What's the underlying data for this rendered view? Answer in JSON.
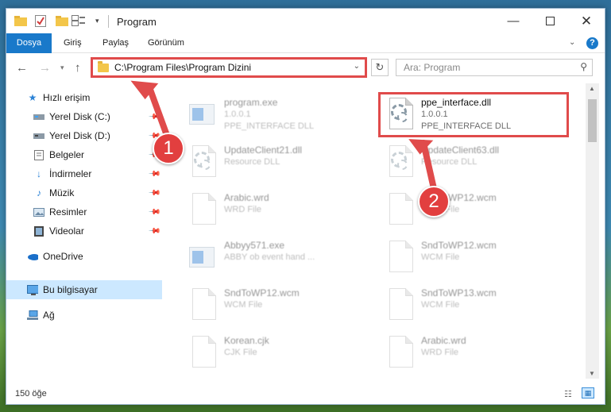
{
  "window": {
    "title": "Program"
  },
  "ribbon": {
    "tabs": [
      {
        "label": "Dosya"
      },
      {
        "label": "Giriş"
      },
      {
        "label": "Paylaş"
      },
      {
        "label": "Görünüm"
      }
    ],
    "help_label": "?"
  },
  "navbar": {
    "address": "C:\\Program Files\\Program Dizini",
    "search_placeholder": "Ara: Program"
  },
  "sidebar": {
    "items": [
      {
        "label": "Hızlı erişim",
        "icon": "star-icon"
      },
      {
        "label": "Yerel Disk (C:)",
        "icon": "drive-icon"
      },
      {
        "label": "Yerel Disk (D:)",
        "icon": "drive-icon"
      },
      {
        "label": "Belgeler",
        "icon": "documents-icon"
      },
      {
        "label": "İndirmeler",
        "icon": "download-icon"
      },
      {
        "label": "Müzik",
        "icon": "music-icon"
      },
      {
        "label": "Resimler",
        "icon": "pictures-icon"
      },
      {
        "label": "Videolar",
        "icon": "video-icon"
      },
      {
        "label": "OneDrive",
        "icon": "cloud-icon"
      },
      {
        "label": "Bu bilgisayar",
        "icon": "computer-icon"
      },
      {
        "label": "Ağ",
        "icon": "network-icon"
      }
    ]
  },
  "files": [
    {
      "name": "program.exe",
      "line1": "1.0.0.1",
      "line2": "PPE_INTERFACE DLL"
    },
    {
      "name": "ppe_interface.dll",
      "line1": "1.0.0.1",
      "line2": "PPE_INTERFACE DLL"
    },
    {
      "name": "UpdateClient21.dll",
      "line1": "Resource DLL"
    },
    {
      "name": "UpdateClient63.dll",
      "line1": "Resource DLL"
    },
    {
      "name": "Arabic.wrd",
      "line1": "WRD File"
    },
    {
      "name": "SndToWP12.wcm",
      "line1": "WCM File"
    },
    {
      "name": "Abbyy571.exe",
      "line1": "ABBY ob event hand ..."
    },
    {
      "name": "SndToWP12.wcm",
      "line1": "WCM File"
    },
    {
      "name": "SndToWP12.wcm",
      "line1": "WCM File"
    },
    {
      "name": "SndToWP13.wcm",
      "line1": "WCM File"
    },
    {
      "name": "Korean.cjk",
      "line1": "CJK File"
    },
    {
      "name": "Arabic.wrd",
      "line1": "WRD File"
    }
  ],
  "status": {
    "item_count": "150 öğe"
  },
  "annotations": {
    "badge1": "1",
    "badge2": "2",
    "arrow_color": "#e04b4b"
  },
  "colors": {
    "accent": "#1979ca",
    "selected": "#cce8ff",
    "highlight": "#e04b4b"
  }
}
